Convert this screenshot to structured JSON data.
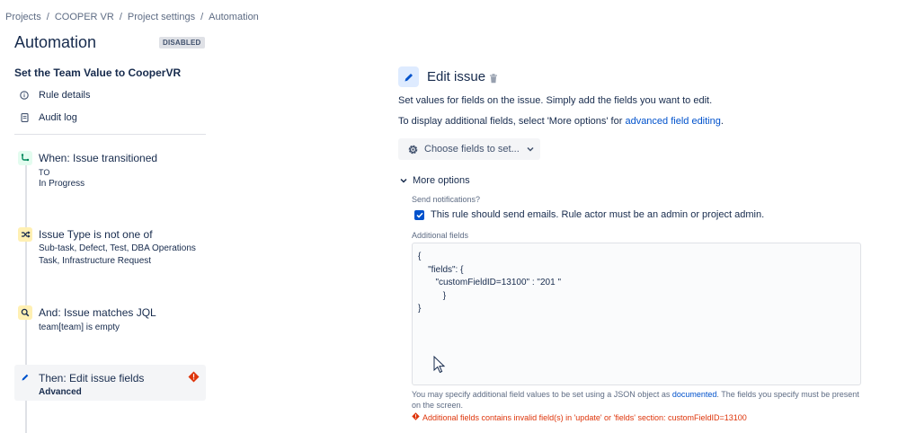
{
  "breadcrumb": {
    "items": [
      "Projects",
      "COOPER VR",
      "Project settings",
      "Automation"
    ],
    "separator": "/"
  },
  "page": {
    "title": "Automation",
    "status": "DISABLED"
  },
  "rule": {
    "name": "Set the Team Value to CooperVR"
  },
  "sidebar": {
    "links": [
      {
        "label": "Rule details",
        "icon": "info-icon"
      },
      {
        "label": "Audit log",
        "icon": "document-icon"
      }
    ]
  },
  "steps": [
    {
      "title": "When: Issue transitioned",
      "sub1": "TO",
      "sub2": "In Progress",
      "icon": "transition-icon"
    },
    {
      "title": "Issue Type is not one of",
      "sub1": "Sub-task, Defect, Test, DBA Operations",
      "sub2": "Task, Infrastructure Request",
      "icon": "shuffle-icon"
    },
    {
      "title": "And: Issue matches JQL",
      "sub1": "team[team] is empty",
      "icon": "search-icon"
    },
    {
      "title": "Then: Edit issue fields",
      "sub1": "Advanced",
      "icon": "pencil-icon",
      "error": true
    }
  ],
  "editor": {
    "title": "Edit issue",
    "desc1": "Set values for fields on the issue. Simply add the fields you want to edit.",
    "desc2_prefix": "To display additional fields, select 'More options' for ",
    "desc2_link": "advanced field editing",
    "desc2_suffix": ".",
    "choose_button": "Choose fields to set...",
    "more_options": "More options",
    "send_notifications_label": "Send notifications?",
    "send_notifications_text": "This rule should send emails. Rule actor must be an admin or project admin.",
    "send_notifications_checked": true,
    "additional_fields_label": "Additional fields",
    "additional_fields_value": "{\n    \"fields\": {\n       \"customFieldID=13100\" : \"201 \"\n          }\n}",
    "help_prefix": "You may specify additional field values to be set using a JSON object as ",
    "help_link": "documented",
    "help_suffix": ". The fields you specify must be present on the screen.",
    "error": "Additional fields contains invalid field(s) in 'update' or 'fields' section: customFieldID=13100"
  },
  "colors": {
    "link": "#0052cc",
    "error": "#de350b",
    "checkbox": "#0052cc"
  }
}
